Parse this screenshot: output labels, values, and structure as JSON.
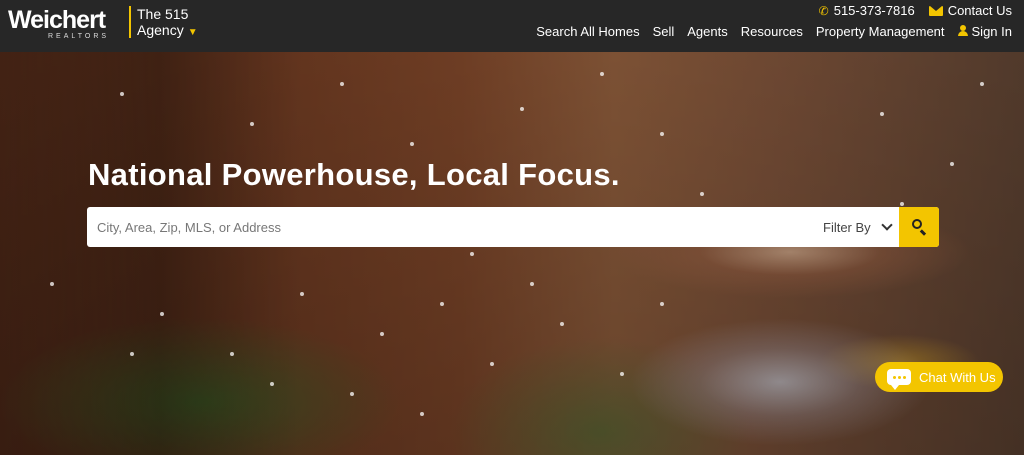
{
  "brand": {
    "logo_text": "Weichert",
    "logo_subtext": "REALTORS",
    "agency_line1": "The 515",
    "agency_line2": "Agency"
  },
  "contact": {
    "phone": "515-373-7816",
    "contact_label": "Contact Us"
  },
  "nav": {
    "items": [
      "Search All Homes",
      "Sell",
      "Agents",
      "Resources",
      "Property Management"
    ],
    "sign_in": "Sign In"
  },
  "hero": {
    "title": "National Powerhouse, Local Focus.",
    "search_placeholder": "City, Area, Zip, MLS, or Address",
    "filter_label": "Filter By"
  },
  "chat": {
    "label": "Chat With Us"
  },
  "colors": {
    "accent": "#f3c500",
    "header_bg": "#272727"
  }
}
